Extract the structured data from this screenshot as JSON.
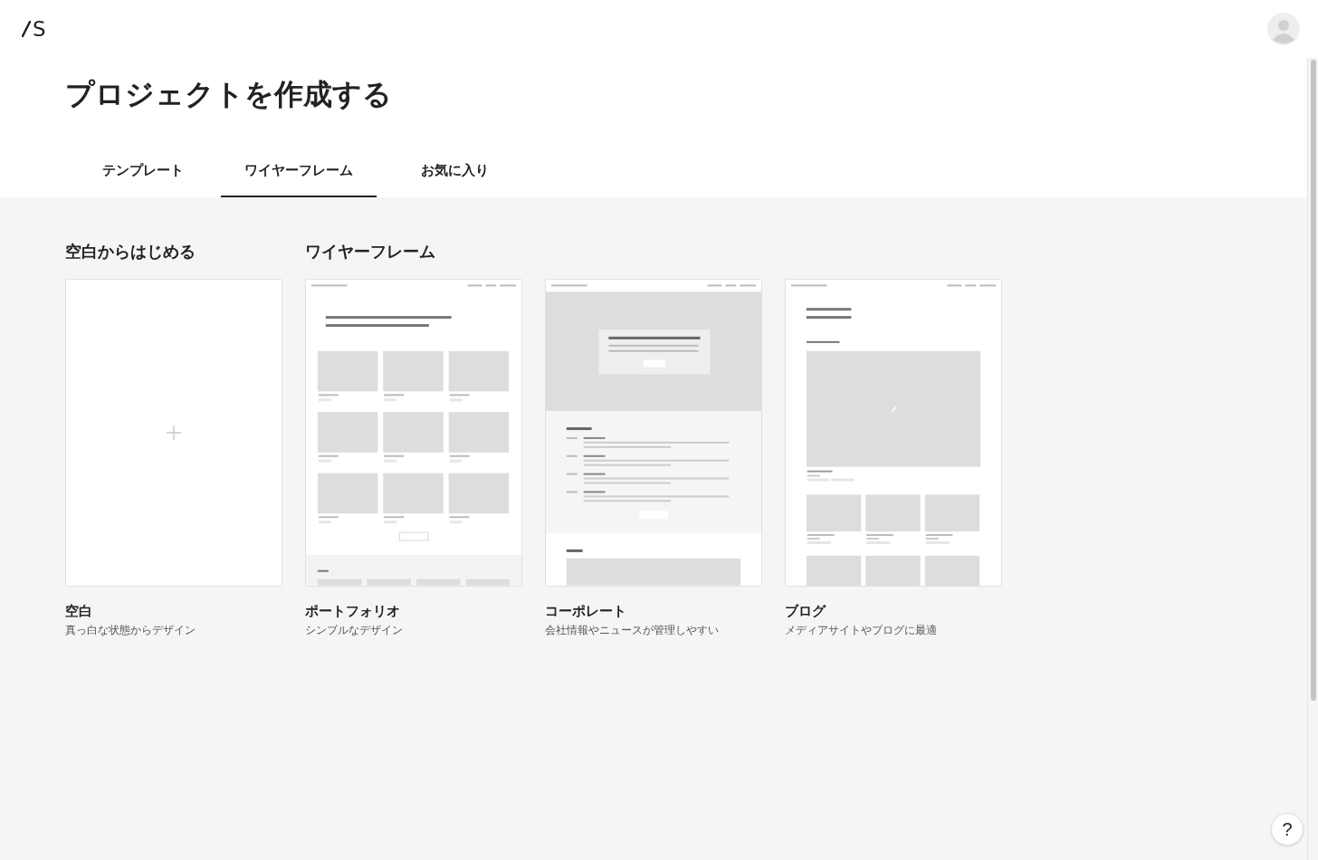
{
  "header": {
    "logo": "S"
  },
  "title": "プロジェクトを作成する",
  "tabs": [
    {
      "label": "テンプレート",
      "selected": false
    },
    {
      "label": "ワイヤーフレーム",
      "selected": true
    },
    {
      "label": "お気に入り",
      "selected": false
    }
  ],
  "sections": [
    {
      "heading": "空白からはじめる",
      "cards": [
        {
          "kind": "blank",
          "name": "空白",
          "description": "真っ白な状態からデザイン"
        }
      ]
    },
    {
      "heading": "ワイヤーフレーム",
      "cards": [
        {
          "kind": "portfolio",
          "name": "ポートフォリオ",
          "description": "シンプルなデザイン"
        },
        {
          "kind": "corporate",
          "name": "コーポレート",
          "description": "会社情報やニュースが管理しやすい"
        },
        {
          "kind": "blog",
          "name": "ブログ",
          "description": "メディアサイトやブログに最適"
        }
      ]
    }
  ],
  "help_button": "?"
}
